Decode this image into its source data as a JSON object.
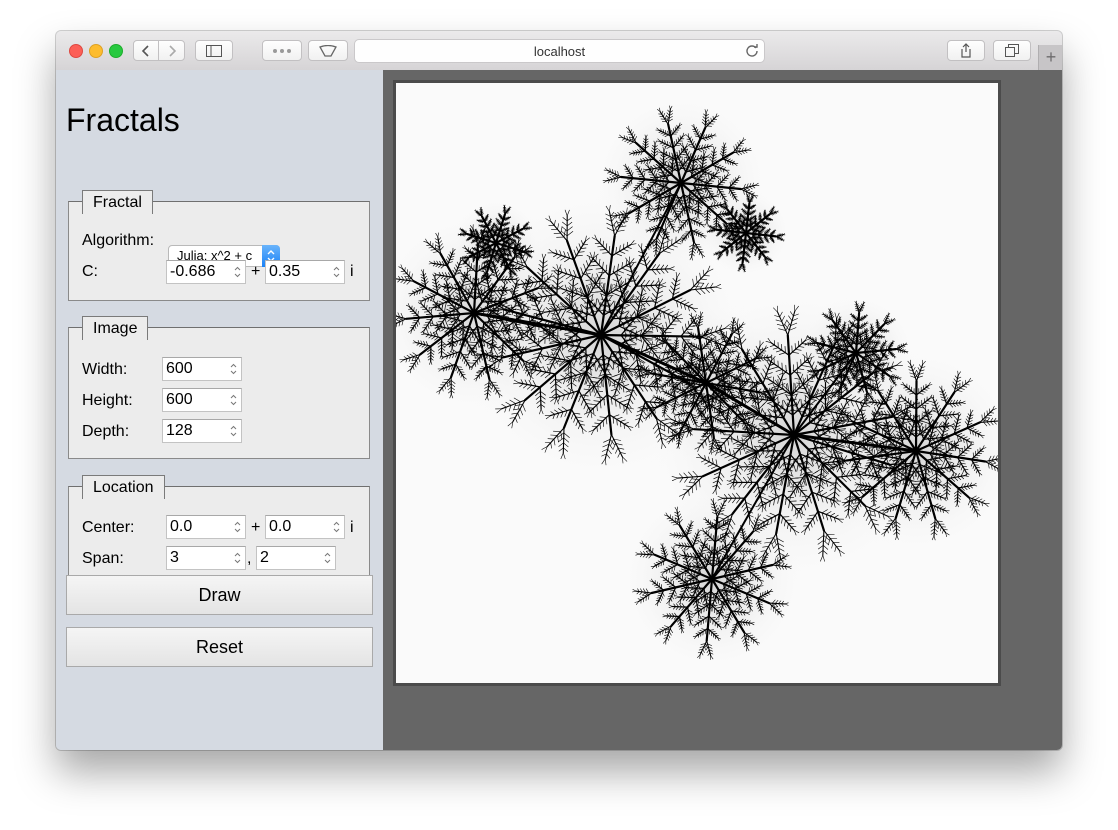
{
  "browser": {
    "url": "localhost"
  },
  "app": {
    "title": "Fractals"
  },
  "fractal_group": {
    "legend": "Fractal",
    "algorithm_label": "Algorithm:",
    "algorithm_value": "Julia: x^2 + c",
    "c_label": "C:",
    "c_real": "-0.686",
    "plus": "+",
    "c_imag": "0.35",
    "i_suffix": "i"
  },
  "image_group": {
    "legend": "Image",
    "width_label": "Width:",
    "width_value": "600",
    "height_label": "Height:",
    "height_value": "600",
    "depth_label": "Depth:",
    "depth_value": "128"
  },
  "location_group": {
    "legend": "Location",
    "center_label": "Center:",
    "center_real": "0.0",
    "plus": "+",
    "center_imag": "0.0",
    "i_suffix": "i",
    "span_label": "Span:",
    "span_x": "3",
    "comma": ",",
    "span_y": "2"
  },
  "buttons": {
    "draw": "Draw",
    "reset": "Reset"
  },
  "colors": {
    "sidebar_bg": "#d5dae2",
    "content_bg": "#666666",
    "fractal": "#000000",
    "select_accent": "#1a82f7"
  }
}
